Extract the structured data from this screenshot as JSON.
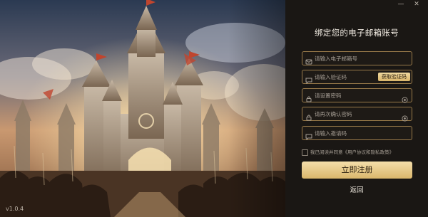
{
  "app": {
    "version": "v1.0.4"
  },
  "window_controls": {
    "minimize": "—",
    "close": "✕"
  },
  "form": {
    "title": "绑定您的电子邮箱账号",
    "email_placeholder": "请输入电子邮箱号",
    "code_placeholder": "请输入验证码",
    "get_code_label": "获取验证码",
    "password_placeholder": "请设置密码",
    "confirm_placeholder": "请再次确认密码",
    "invite_placeholder": "请输入邀请码",
    "agreement_text": "我已阅读并同意《用户协议和隐私政策》",
    "agreement_checked": false,
    "submit_label": "立即注册",
    "back_label": "返回"
  },
  "icons": {
    "email": "envelope-icon",
    "code": "chat-bubble-icon",
    "password": "lock-icon",
    "password_toggle": "eye-icon",
    "invite": "chat-bubble-icon"
  },
  "colors": {
    "accent": "#dcb86e",
    "border": "#9a7b4a",
    "panel_bg": "#1a1714"
  }
}
